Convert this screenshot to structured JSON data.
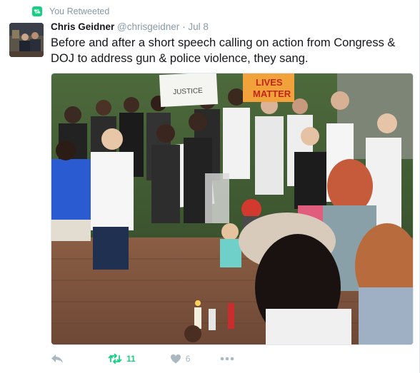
{
  "context": {
    "text": "You Retweeted",
    "icon": "retweet-icon",
    "color": "#19cf86"
  },
  "tweet": {
    "author_name": "Chris Geidner",
    "handle": "@chrisgeidner",
    "separator": "·",
    "time": "Jul 8",
    "text": "Before and after a short speech calling on action from Congress & DOJ to address gun & police violence, they sang.",
    "media": {
      "sign_left": "JUSTICE",
      "sign_right_line1": "LIVES",
      "sign_right_line2": "MATTER"
    }
  },
  "actions": {
    "reply_icon": "reply-icon",
    "retweet_icon": "retweet-icon",
    "retweet_count": "11",
    "like_icon": "heart-icon",
    "like_count": "6",
    "more_icon": "more-icon"
  },
  "colors": {
    "retweeted": "#19cf86",
    "muted": "#8899a6",
    "text": "#14171a"
  }
}
